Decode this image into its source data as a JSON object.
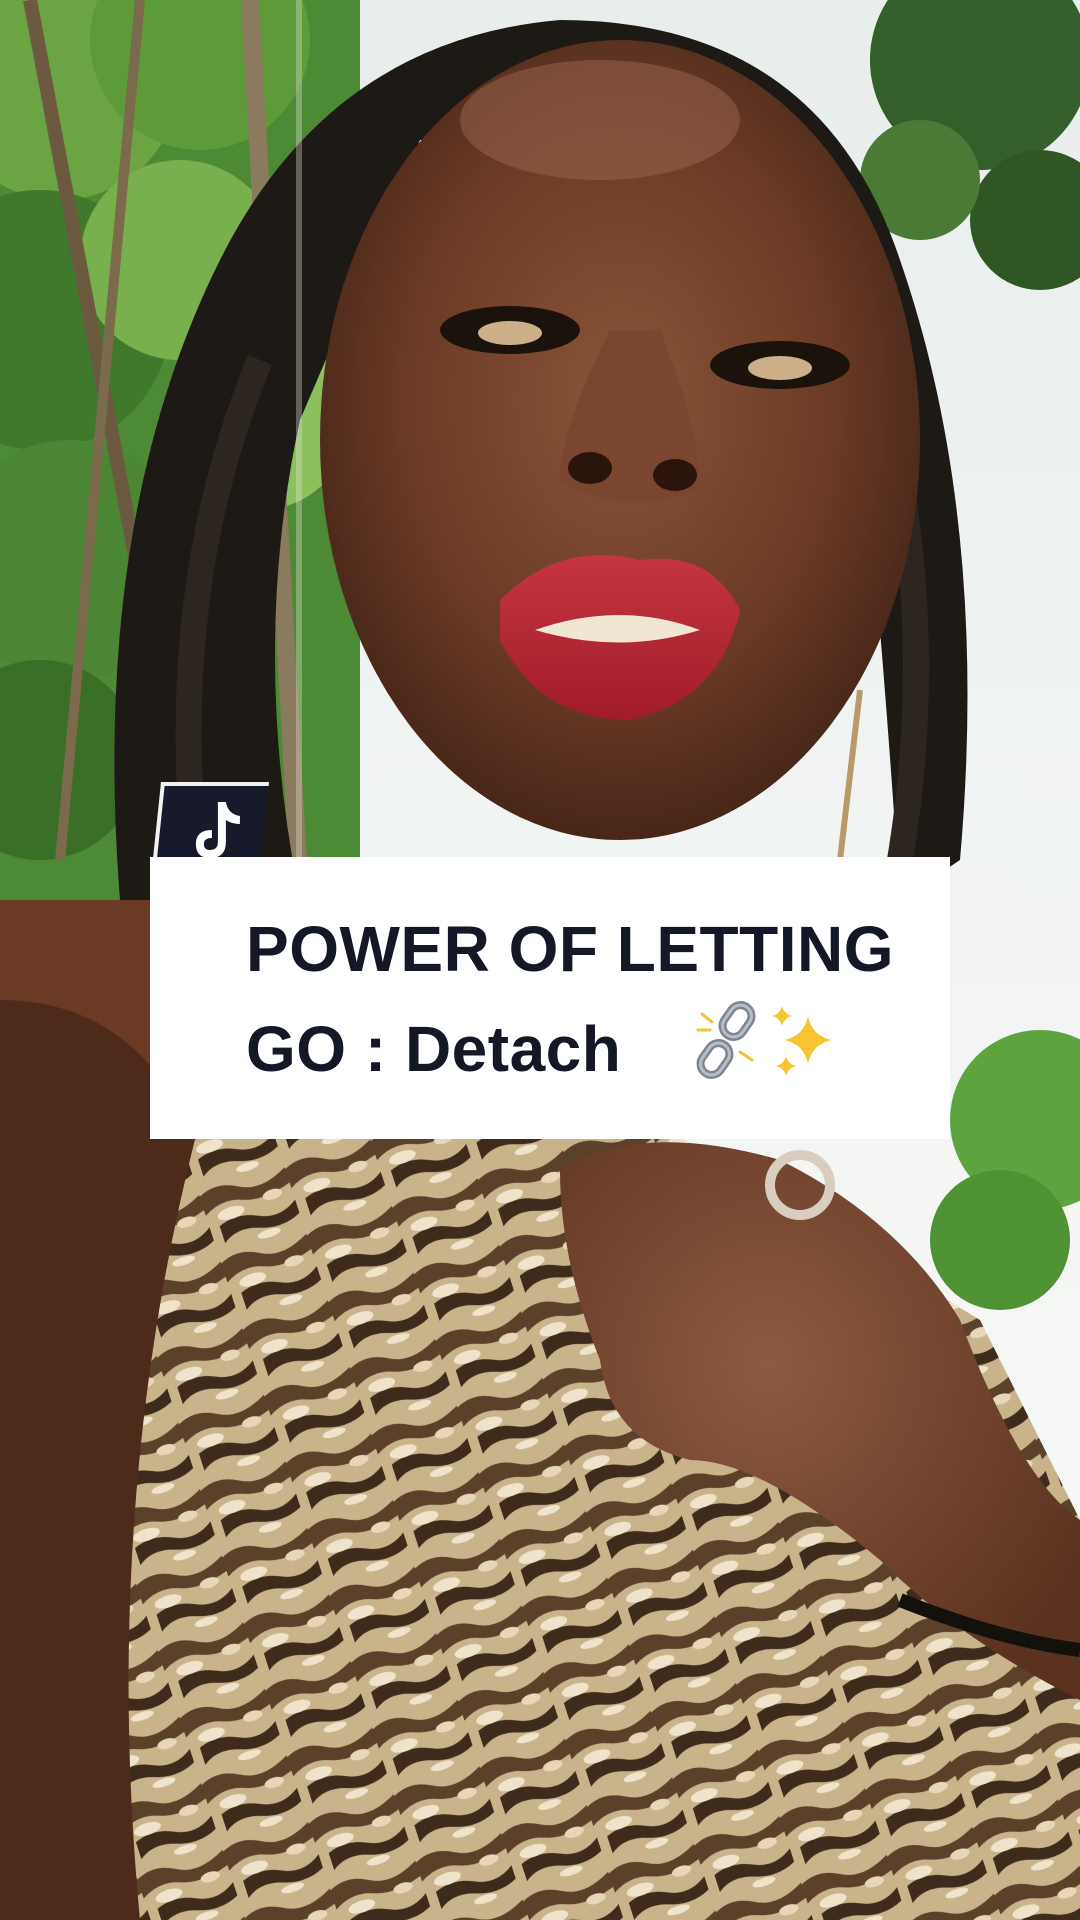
{
  "caption": {
    "line1": "POWER OF LETTING",
    "line2": "GO : Detach"
  },
  "badge": {
    "icon": "tiktok-note-icon"
  },
  "emoji": {
    "chain": "broken-chain-icon",
    "sparkles": "sparkles-icon"
  },
  "colors": {
    "caption_text": "#141726",
    "caption_bg": "#ffffff",
    "badge_bg": "#161a2a",
    "lip": "#b8232e",
    "skin": "#6b3c27",
    "hair": "#1d1915",
    "foliage": "#3f7a2c",
    "sky": "#f4f6f4",
    "fabric_light": "#d9c7a6",
    "fabric_dark": "#4b3522"
  }
}
